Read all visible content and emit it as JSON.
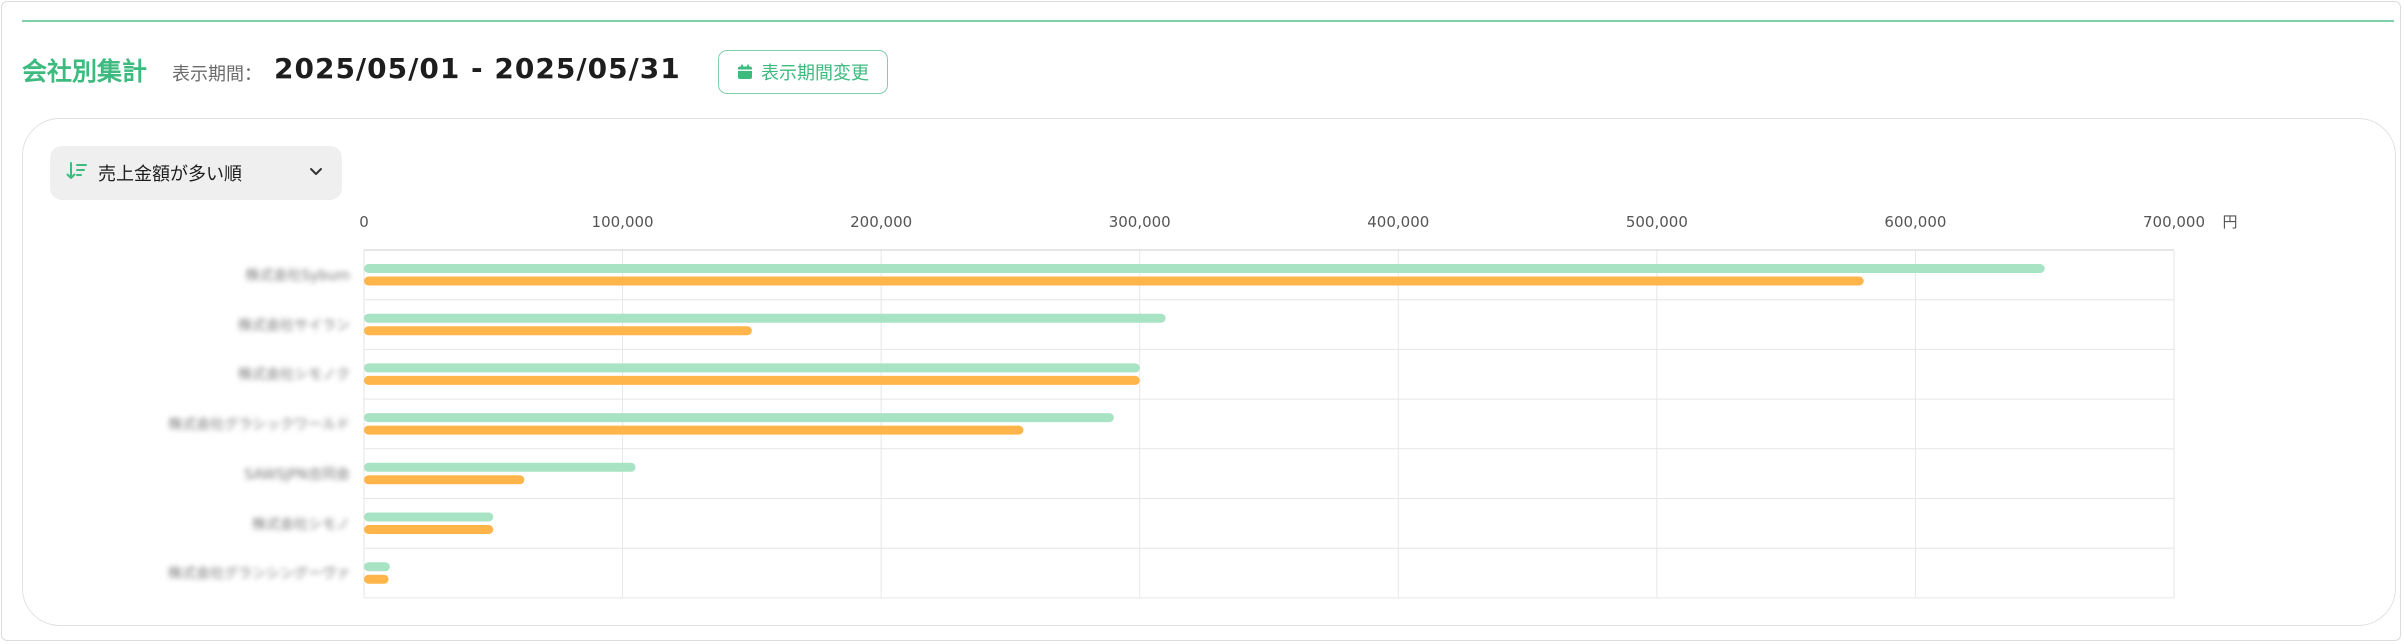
{
  "header": {
    "title": "会社別集計",
    "period_label": "表示期間：",
    "period_value": "2025/05/01 - 2025/05/31",
    "change_button_label": "表示期間変更",
    "change_button_icon": "calendar-icon"
  },
  "sort": {
    "icon": "sort-descending-icon",
    "selected_label": "売上金額が多い順",
    "chevron_icon": "chevron-down-icon"
  },
  "colors": {
    "accent": "#3dbb7f",
    "series_green": "#a8e3c4",
    "series_orange": "#ffb54a"
  },
  "chart_data": {
    "type": "bar",
    "orientation": "horizontal",
    "unit": "円",
    "xlim": [
      0,
      700000
    ],
    "ticks": [
      "0",
      "100,000",
      "200,000",
      "300,000",
      "400,000",
      "500,000",
      "600,000",
      "700,000"
    ],
    "grid": true,
    "categories": [
      "株式会社Sybum",
      "株式会社サイラン",
      "株式会社シモノク",
      "株式会社グラシックワールド",
      "SAWSJPN合同会",
      "株式会社シモノ",
      "株式会社グランシングーヴァ"
    ],
    "series": [
      {
        "values": [
          650000,
          310000,
          300000,
          290000,
          105000,
          50000,
          10000
        ]
      },
      {
        "values": [
          580000,
          150000,
          300000,
          255000,
          62000,
          50000,
          9500
        ]
      }
    ]
  }
}
